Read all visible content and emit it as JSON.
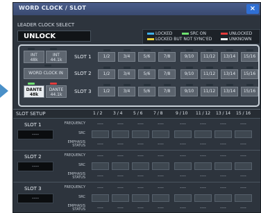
{
  "window": {
    "title": "WORD CLOCK / SLOT",
    "close_glyph": "×"
  },
  "leader": {
    "label": "LEADER CLOCK SELECT",
    "value": "UNLOCK"
  },
  "legend": {
    "locked": {
      "text": "LOCKED",
      "color": "#3fb0e8"
    },
    "locked_not_synced": {
      "text": "LOCKED BUT NOT SYNC'ED",
      "color": "#e8d23a"
    },
    "src_on": {
      "text": "SRC ON",
      "color": "#6ee070"
    },
    "unlocked": {
      "text": "UNLOCKED",
      "color": "#e23b3b"
    },
    "unknown": {
      "text": "UNKNOWN",
      "color": "#e8ecf0"
    }
  },
  "clock_sources": {
    "int48": "INT\n48k",
    "int441": "INT\n44.1k",
    "word_clock_in": "WORD CLOCK IN",
    "dante48": "DANTE\n48k",
    "dante441": "DANTE\n44.1k"
  },
  "slots": [
    {
      "label": "SLOT 1"
    },
    {
      "label": "SLOT 2"
    },
    {
      "label": "SLOT 3"
    }
  ],
  "pairs": [
    "1/2",
    "3/4",
    "5/6",
    "7/8",
    "9/10",
    "11/12",
    "13/14",
    "15/16"
  ],
  "slot_setup": {
    "title": "SLOT SETUP",
    "columns": [
      "1 / 2",
      "3 / 4",
      "5 / 6",
      "7 / 8",
      "9 / 10",
      "11 / 12",
      "13 / 14",
      "15 / 16"
    ],
    "row_labels": {
      "frequency": "FREQUENCY",
      "src": "SRC",
      "emphasis": "EMPHASIS\nSTATUS"
    },
    "slots": [
      {
        "label": "SLOT 1",
        "value": "----"
      },
      {
        "label": "SLOT 2",
        "value": "----"
      },
      {
        "label": "SLOT 3",
        "value": "----"
      }
    ],
    "dash": "----"
  }
}
